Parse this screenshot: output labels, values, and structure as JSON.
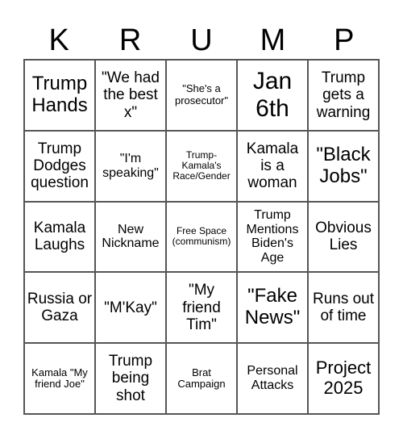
{
  "header": [
    "K",
    "R",
    "U",
    "M",
    "P"
  ],
  "cells": [
    {
      "text": "Trump Hands",
      "size": "s-xxl"
    },
    {
      "text": "\"We had the best x\"",
      "size": "s-lg"
    },
    {
      "text": "\"She's a prosecutor\"",
      "size": "s-sm"
    },
    {
      "text": "Jan 6th",
      "size": "s-huge"
    },
    {
      "text": "Trump gets a warning",
      "size": "s-lg"
    },
    {
      "text": "Trump Dodges question",
      "size": "s-lg"
    },
    {
      "text": "\"I'm speaking\"",
      "size": "s-md"
    },
    {
      "text": "Trump- Kamala's Race/Gender",
      "size": "s-xs"
    },
    {
      "text": "Kamala is a woman",
      "size": "s-lg"
    },
    {
      "text": "\"Black Jobs\"",
      "size": "s-xxl"
    },
    {
      "text": "Kamala Laughs",
      "size": "s-lg"
    },
    {
      "text": "New Nickname",
      "size": "s-md"
    },
    {
      "text": "Free Space (communism)",
      "size": "s-xs"
    },
    {
      "text": "Trump Mentions Biden's Age",
      "size": "s-md"
    },
    {
      "text": "Obvious Lies",
      "size": "s-lg"
    },
    {
      "text": "Russia or Gaza",
      "size": "s-lg"
    },
    {
      "text": "\"M'Kay\"",
      "size": "s-lg"
    },
    {
      "text": "\"My friend Tim\"",
      "size": "s-lg"
    },
    {
      "text": "\"Fake News\"",
      "size": "s-xxl"
    },
    {
      "text": "Runs out of time",
      "size": "s-lg"
    },
    {
      "text": "Kamala \"My friend Joe\"",
      "size": "s-sm"
    },
    {
      "text": "Trump being shot",
      "size": "s-lg"
    },
    {
      "text": "Brat Campaign",
      "size": "s-sm"
    },
    {
      "text": "Personal Attacks",
      "size": "s-md"
    },
    {
      "text": "Project 2025",
      "size": "s-xl"
    }
  ]
}
